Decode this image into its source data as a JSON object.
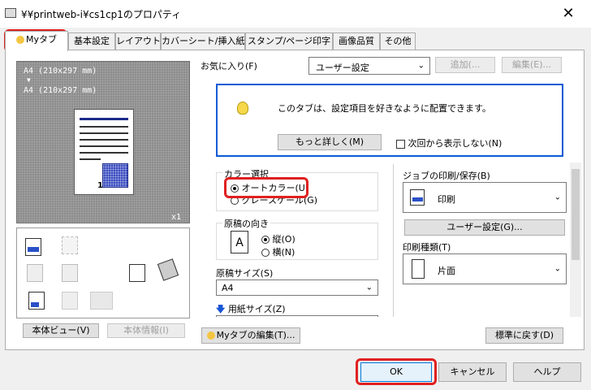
{
  "window": {
    "title": "¥¥printweb-i¥cs1cp1のプロパティ",
    "close": "✕"
  },
  "tabs": [
    "Myタブ",
    "基本設定",
    "レイアウト",
    "カバーシート/挿入紙",
    "スタンプ/ページ印字",
    "画像品質",
    "その他"
  ],
  "preview": {
    "line1": "A4 (210x297 mm)",
    "arrow": "▼",
    "line2": "A4 (210x297 mm)",
    "page_num": "1",
    "copies": "x1"
  },
  "left_buttons": {
    "printer_view": "本体ビュー(V)",
    "printer_info": "本体情報(I)"
  },
  "favorites": {
    "label": "お気に入り(F)",
    "value": "ユーザー設定",
    "add": "追加(...",
    "edit": "編集(E)..."
  },
  "info": {
    "message": "このタブは、設定項目を好きなように配置できます。",
    "more": "もっと詳しく(M)",
    "hide": "次回から表示しない(N)"
  },
  "color": {
    "label": "カラー選択",
    "auto": "オートカラー(U)",
    "gray": "グレースケール(G)"
  },
  "orientation": {
    "label": "原稿の向き",
    "portrait": "縦(O)",
    "landscape": "横(N)"
  },
  "original_size": {
    "label": "原稿サイズ(S)",
    "value": "A4"
  },
  "paper_size": {
    "label": "用紙サイズ(Z)"
  },
  "job": {
    "label": "ジョブの印刷/保存(B)",
    "value": "印刷",
    "user_settings": "ユーザー設定(G)..."
  },
  "print_type": {
    "label": "印刷種類(T)",
    "value": "片面"
  },
  "bottom": {
    "edit_mytab": "Myタブの編集(T)...",
    "default": "標準に戻す(D)"
  },
  "dialog": {
    "ok": "OK",
    "cancel": "キャンセル",
    "help": "ヘルプ"
  },
  "colors": {
    "accent": "#0054a6",
    "highlight": "#e02020",
    "preview_bg": "#8c8c8c",
    "info_border": "#0a5bd6"
  }
}
